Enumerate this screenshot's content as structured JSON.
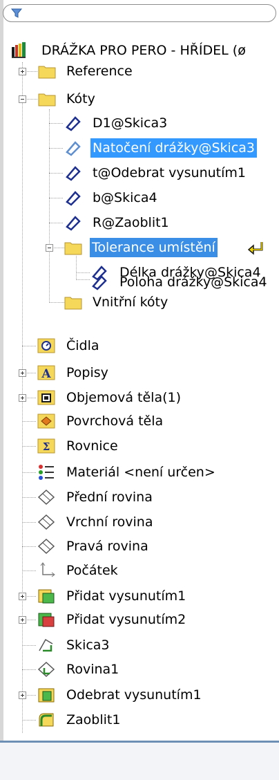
{
  "filter": {
    "placeholder": ""
  },
  "root": {
    "label": "DRÁŽKA PRO PERO - HŘÍDEL  (ø"
  },
  "tree": {
    "reference": "Reference",
    "koty": "Kóty",
    "d1": "D1@Skica3",
    "natoceni": "Natočení drážky@Skica3",
    "t": "t@Odebrat vysunutím1",
    "b": "b@Skica4",
    "r": "R@Zaoblit1",
    "tolerance": "Tolerance umístění",
    "delka": "Délka drážky@Skica4",
    "poloha": "Poloha drážky@Skica4",
    "vnitrni": "Vnitřní kóty",
    "cidla": "Čidla",
    "popisy": "Popisy",
    "objemova": "Objemová těla(1)",
    "povrchova": "Povrchová těla",
    "rovnice": "Rovnice",
    "material": "Materiál <není určen>",
    "predni": "Přední rovina",
    "vrchni": "Vrchní rovina",
    "prava": "Pravá rovina",
    "pocatek": "Počátek",
    "pridat1": "Přidat vysunutím1",
    "pridat2": "Přidat vysunutím2",
    "skica3": "Skica3",
    "rovina1": "Rovina1",
    "odebrat1": "Odebrat vysunutím1",
    "zaoblit1": "Zaoblit1"
  },
  "colors": {
    "selection": "#3399ff",
    "folder": "#f5d75a",
    "accent": "#6d8fb6"
  }
}
